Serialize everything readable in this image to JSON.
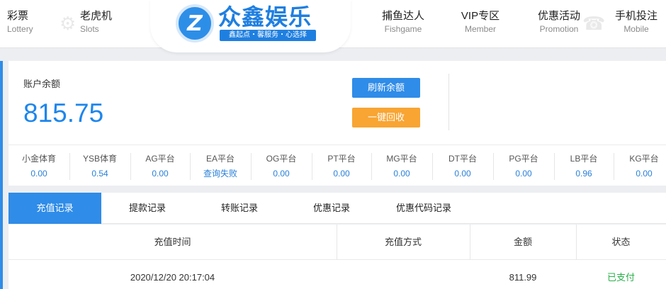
{
  "nav": {
    "left": [
      {
        "zh": "彩票",
        "en": "Lottery"
      },
      {
        "zh": "老虎机",
        "en": "Slots"
      }
    ],
    "right": [
      {
        "zh": "捕鱼达人",
        "en": "Fishgame"
      },
      {
        "zh": "VIP专区",
        "en": "Member"
      },
      {
        "zh": "优惠活动",
        "en": "Promotion"
      },
      {
        "zh": "手机投注",
        "en": "Mobile"
      }
    ]
  },
  "logo": {
    "mark": "Z",
    "name": "众鑫娱乐",
    "slogan": "鑫起点・馨服务・心选择"
  },
  "account": {
    "balance_label": "账户余额",
    "balance": "815.75",
    "refresh_label": "刷新余额",
    "recall_label": "一键回收"
  },
  "platforms": [
    {
      "name": "小金体育",
      "value": "0.00"
    },
    {
      "name": "YSB体育",
      "value": "0.54"
    },
    {
      "name": "AG平台",
      "value": "0.00"
    },
    {
      "name": "EA平台",
      "value": "查询失败"
    },
    {
      "name": "OG平台",
      "value": "0.00"
    },
    {
      "name": "PT平台",
      "value": "0.00"
    },
    {
      "name": "MG平台",
      "value": "0.00"
    },
    {
      "name": "DT平台",
      "value": "0.00"
    },
    {
      "name": "PG平台",
      "value": "0.00"
    },
    {
      "name": "LB平台",
      "value": "0.96"
    },
    {
      "name": "KG平台",
      "value": "0.00"
    }
  ],
  "tabs": [
    "充值记录",
    "提款记录",
    "转账记录",
    "优惠记录",
    "优惠代码记录"
  ],
  "table": {
    "headers": [
      "充值时间",
      "充值方式",
      "金额",
      "状态"
    ],
    "rows": [
      {
        "time": "2020/12/20 20:17:04",
        "method": "",
        "amount": "811.99",
        "status": "已支付"
      }
    ]
  },
  "colors": {
    "accent": "#2f8ce8",
    "balance": "#1d86ec",
    "recall_button": "#f8a533",
    "paid_status": "#29b04a"
  }
}
